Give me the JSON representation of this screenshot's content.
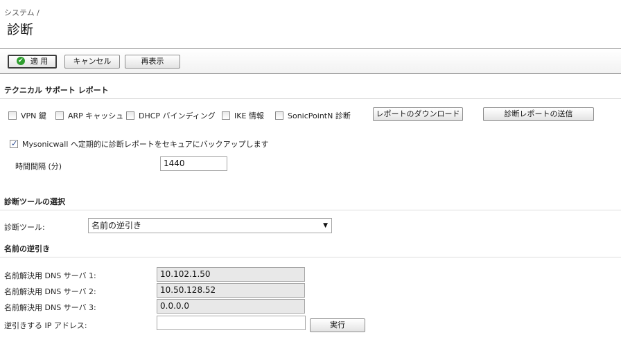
{
  "breadcrumb": "システム /",
  "page_title": "診断",
  "toolbar": {
    "apply_label": "適 用",
    "cancel_label": "キャンセル",
    "refresh_label": "再表示"
  },
  "tsr": {
    "heading": "テクニカル サポート レポート",
    "options": [
      {
        "label": "VPN 鍵",
        "checked": false
      },
      {
        "label": "ARP キャッシュ",
        "checked": false
      },
      {
        "label": "DHCP バインディング",
        "checked": false
      },
      {
        "label": "IKE 情報",
        "checked": false
      },
      {
        "label": "SonicPointN 診断",
        "checked": false
      }
    ],
    "download_label": "レポートのダウンロード",
    "send_label": "診断レポートの送信",
    "backup_label": "Mysonicwall へ定期的に診断レポートをセキュアにバックアップします",
    "backup_checked": true,
    "interval_label": "時間間隔 (分)",
    "interval_value": "1440"
  },
  "tool_select": {
    "heading": "診断ツールの選択",
    "label": "診断ツール:",
    "value": "名前の逆引き"
  },
  "reverse_lookup": {
    "heading": "名前の逆引き",
    "dns1_label": "名前解決用 DNS サーバ 1:",
    "dns1_value": "10.102.1.50",
    "dns2_label": "名前解決用 DNS サーバ 2:",
    "dns2_value": "10.50.128.52",
    "dns3_label": "名前解決用 DNS サーバ 3:",
    "dns3_value": "0.0.0.0",
    "ip_label": "逆引きする IP アドレス:",
    "ip_value": "",
    "run_label": "実行"
  }
}
